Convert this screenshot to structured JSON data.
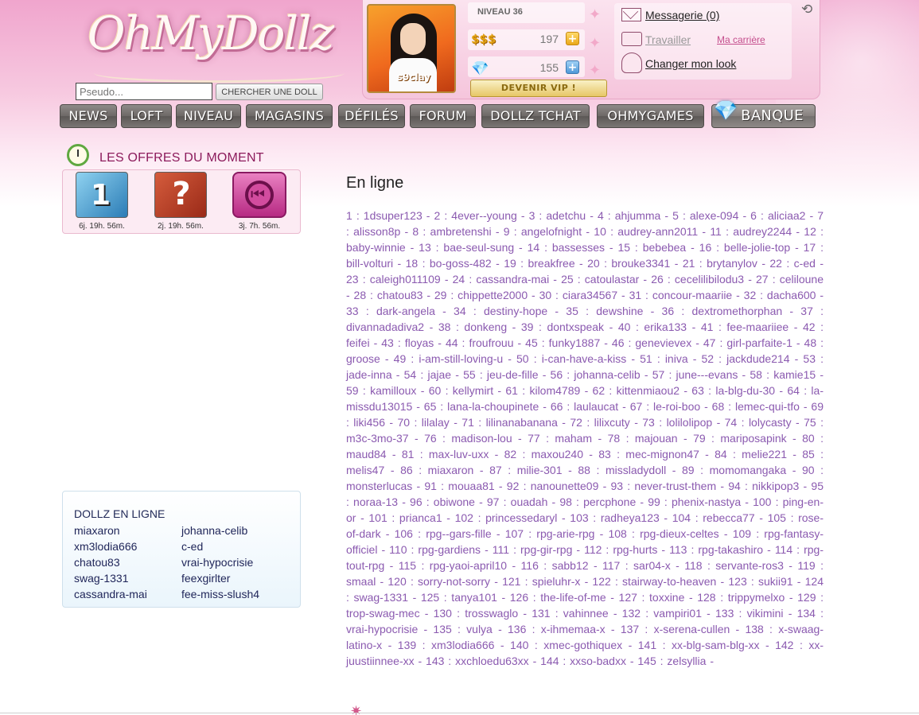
{
  "brand": {
    "logo_text": "OhMyDollz"
  },
  "search": {
    "placeholder": "Pseudo...",
    "button_label": "CHERCHER UNE DOLL"
  },
  "profile": {
    "avatar_name": "s9clay",
    "level_label": "NIVEAU 36",
    "money_icon_text": "$$$",
    "money_value": "197",
    "diamonds_value": "155",
    "plus_label": "+",
    "vip_button_label": "DEVENIR VIP !"
  },
  "account_links": {
    "messages": "Messagerie (0)",
    "work": "Travailler",
    "career": "Ma carrière",
    "change_look": "Changer mon look"
  },
  "nav": {
    "items": [
      "NEWS",
      "LOFT",
      "NIVEAU",
      "MAGASINS",
      "DÉFILÉS",
      "FORUM",
      "DOLLZ TCHAT",
      "OHMYGAMES",
      "BANQUE"
    ]
  },
  "offers": {
    "title": "LES OFFRES DU MOMENT",
    "items": [
      {
        "icon": "number-one-icon",
        "badge": "1",
        "time": "6j. 19h. 56m."
      },
      {
        "icon": "question-mark-icon",
        "badge": "?",
        "time": "2j. 19h. 56m."
      },
      {
        "icon": "rewind-icon",
        "time": "3j. 7h. 56m."
      }
    ]
  },
  "online_box": {
    "title": "DOLLZ EN LIGNE",
    "users": [
      "miaxaron",
      "johanna-celib",
      "xm3lodia666",
      "c-ed",
      "chatou83",
      "vrai-hypocrisie",
      "swag-1331",
      "feexgirlter",
      "cassandra-mai",
      "fee-miss-slush4"
    ]
  },
  "main": {
    "title": "En ligne",
    "online_list": "1 : 1dsuper123 - 2 : 4ever--young - 3 : adetchu - 4 : ahjumma - 5 : alexe-094 - 6 : aliciaa2 - 7 : alisson8p - 8 : ambretenshi - 9 : angelofnight - 10 : audrey-ann2011 - 11 : audrey2244 - 12 : baby-winnie - 13 : bae-seul-sung - 14 : bassesses - 15 : bebebea - 16 : belle-jolie-top - 17 : bill-volturi - 18 : bo-goss-482 - 19 : breakfree - 20 : brouke3341 - 21 : brytanylov - 22 : c-ed - 23 : caleigh011109 - 24 : cassandra-mai - 25 : catoulastar - 26 : cecelilibilodu3 - 27 : celiloune - 28 : chatou83 - 29 : chippette2000 - 30 : ciara34567 - 31 : concour-maariie - 32 : dacha600 - 33 : dark-angela - 34 : destiny-hope - 35 : dewshine - 36 : dextromethorphan - 37 : divannadadiva2 - 38 : donkeng - 39 : dontxspeak - 40 : erika133 - 41 : fee-maariiee - 42 : feifei - 43 : floyas - 44 : froufrouu - 45 : funky1887 - 46 : genevievex - 47 : girl-parfaite-1 - 48 : groose - 49 : i-am-still-loving-u - 50 : i-can-have-a-kiss - 51 : iniva - 52 : jackdude214 - 53 : jade-inna - 54 : jajae - 55 : jeu-de-fille - 56 : johanna-celib - 57 : june---evans - 58 : kamie15 - 59 : kamilloux - 60 : kellymirt - 61 : kilom4789 - 62 : kittenmiaou2 - 63 : la-blg-du-30 - 64 : la-missdu13015 - 65 : lana-la-choupinete - 66 : laulaucat - 67 : le-roi-boo - 68 : lemec-qui-tfo - 69 : liki456 - 70 : lilalay - 71 : lilinanabanana - 72 : lilixcuty - 73 : lolilolipop - 74 : lolycasty - 75 : m3c-3mo-37 - 76 : madison-lou - 77 : maham - 78 : majouan - 79 : mariposapink - 80 : maud84 - 81 : max-luv-uxx - 82 : maxou240 - 83 : mec-mignon47 - 84 : melie221 - 85 : melis47 - 86 : miaxaron - 87 : milie-301 - 88 : missladydoll - 89 : momomangaka - 90 : monsterlucas - 91 : mouaa81 - 92 : nanounette09 - 93 : never-trust-them - 94 : nikkipop3 - 95 : noraa-13 - 96 : obiwone - 97 : ouadah - 98 : percphone - 99 : phenix-nastya - 100 : ping-en-or - 101 : prianca1 - 102 : princessedaryl - 103 : radheya123 - 104 : rebecca77 - 105 : rose-of-dark - 106 : rpg--gars-fille - 107 : rpg-arie-rpg - 108 : rpg-dieux-celtes - 109 : rpg-fantasy-officiel - 110 : rpg-gardiens - 111 : rpg-gir-rpg - 112 : rpg-hurts - 113 : rpg-takashiro - 114 : rpg-tout-rpg - 115 : rpg-yaoi-april10 - 116 : sabb12 - 117 : sar04-x - 118 : servante-ros3 - 119 : smaal - 120 : sorry-not-sorry - 121 : spieluhr-x - 122 : stairway-to-heaven - 123 : sukii91 - 124 : swag-1331 - 125 : tanya101 - 126 : the-life-of-me - 127 : toxxine - 128 : trippymelxo - 129 : trop-swag-mec - 130 : trosswaglo - 131 : vahinnee - 132 : vampiri01 - 133 : vikimini - 134 : vrai-hypocrisie - 135 : vulya - 136 : x-ihmemaa-x - 137 : x-serena-cullen - 138 : x-swaag-latino-x - 139 : xm3lodia666 - 140 : xmec-gothiquex - 141 : xx-blg-sam-blg-xx - 142 : xx-juustiinnee-xx - 143 : xxchloedu63xx - 144 : xxso-badxx - 145 : zelsyllia -"
  },
  "colors": {
    "header_pink": "#f0a5cd",
    "nav_gray": "#6d6866",
    "link_purple": "#8b5ab0",
    "offers_title": "#8c1b5c",
    "online_text": "#1e2458"
  }
}
